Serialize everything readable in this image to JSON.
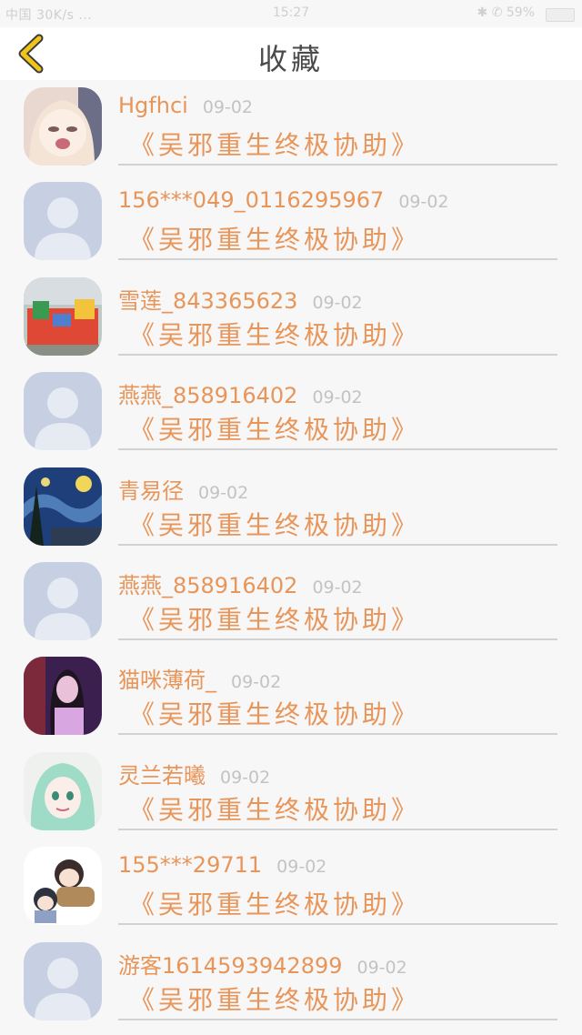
{
  "status_bar": {
    "left": "中国 30K/s ...",
    "time": "15:27",
    "right": "✱ ✆ 59%"
  },
  "header": {
    "title": "收藏",
    "back_icon": "chevron-left-icon",
    "accent_color": "#f0c419"
  },
  "colors": {
    "name": "#e8955a",
    "date": "#c3c3c3",
    "divider": "#d2d2d2"
  },
  "items": [
    {
      "name": "Hgfhci",
      "date": "09-02",
      "book": "《吴邪重生终极协助》",
      "avatar": "anime-girl-crying"
    },
    {
      "name": "156***049_0116295967",
      "date": "09-02",
      "book": "《吴邪重生终极协助》",
      "avatar": "default-person"
    },
    {
      "name": "雪莲_843365623",
      "date": "09-02",
      "book": "《吴邪重生终极协助》",
      "avatar": "bouncy-castle-photo"
    },
    {
      "name": "燕燕_858916402",
      "date": "09-02",
      "book": "《吴邪重生终极协助》",
      "avatar": "default-person"
    },
    {
      "name": "青易径",
      "date": "09-02",
      "book": "《吴邪重生终极协助》",
      "avatar": "starry-night-painting"
    },
    {
      "name": "燕燕_858916402",
      "date": "09-02",
      "book": "《吴邪重生终极协助》",
      "avatar": "default-person"
    },
    {
      "name": "猫咪薄荷_",
      "date": "09-02",
      "book": "《吴邪重生终极协助》",
      "avatar": "girl-purple-photo"
    },
    {
      "name": "灵兰若曦",
      "date": "09-02",
      "book": "《吴邪重生终极协助》",
      "avatar": "anime-green-hair"
    },
    {
      "name": "155***29711",
      "date": "09-02",
      "book": "《吴邪重生终极协助》",
      "avatar": "chibi-characters"
    },
    {
      "name": "游客1614593942899",
      "date": "09-02",
      "book": "《吴邪重生终极协助》",
      "avatar": "default-person"
    }
  ]
}
